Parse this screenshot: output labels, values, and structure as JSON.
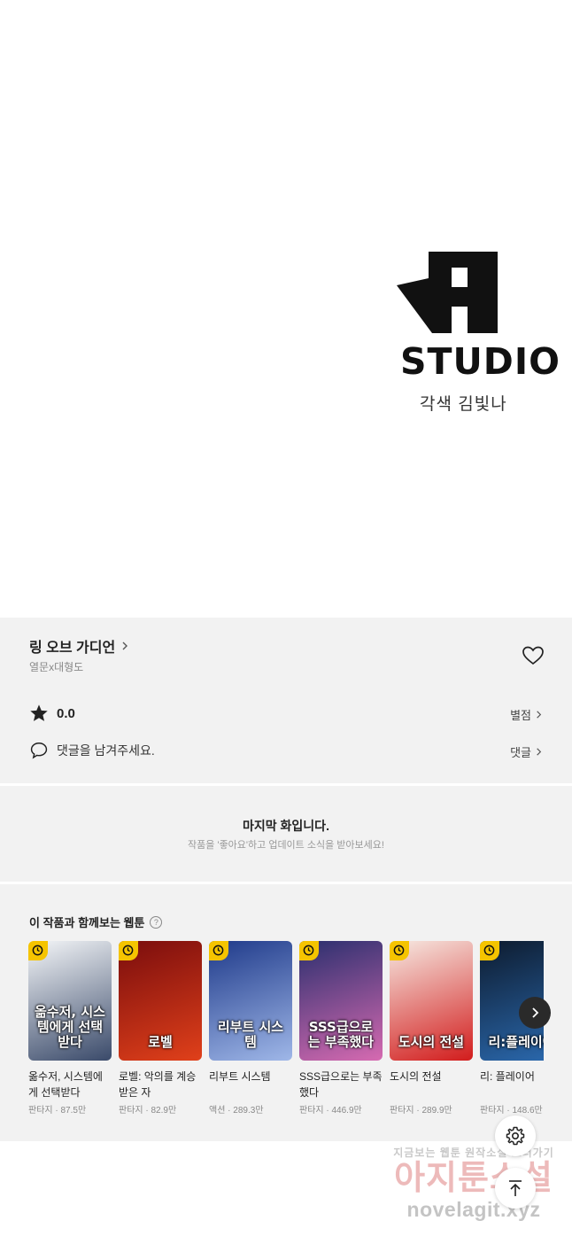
{
  "hero": {
    "logo_word": "STUDIO",
    "credit": "각색 김빛나"
  },
  "info": {
    "title": "링 오브 가디언",
    "authors": "열문x대형도",
    "rating": "0.0",
    "rating_link": "별점",
    "comment_prompt": "댓글을 남겨주세요.",
    "comment_link": "댓글"
  },
  "notice": {
    "title": "마지막 화입니다.",
    "subtitle": "작품을 '좋아요'하고 업데이트 소식을 받아보세요!"
  },
  "recommendations": {
    "heading": "이 작품과 함께보는 웹툰",
    "help_icon_text": "?",
    "items": [
      {
        "title": "옮수저, 시스템에게 선택받다",
        "genre": "판타지",
        "views": "87.5만",
        "cover_text": "옮수저, 시스템에게 선택받다",
        "colors": [
          "#f4f6f8",
          "#3a4a6a"
        ]
      },
      {
        "title": "로벨: 악의를 계승받은 자",
        "genre": "판타지",
        "views": "82.9만",
        "cover_text": "로벨",
        "colors": [
          "#7a0d0d",
          "#e0401a"
        ]
      },
      {
        "title": "리부트 시스템",
        "genre": "액션",
        "views": "289.3만",
        "cover_text": "리부트 시스템",
        "colors": [
          "#1f3a8a",
          "#9fb7e8"
        ]
      },
      {
        "title": "SSS급으로는 부족했다",
        "genre": "판타지",
        "views": "446.9만",
        "cover_text": "SSS급으로는 부족했다",
        "colors": [
          "#2a2f6e",
          "#d66ab1"
        ]
      },
      {
        "title": "도시의 전설",
        "genre": "판타지",
        "views": "289.9만",
        "cover_text": "도시의 전설",
        "colors": [
          "#f6e9e2",
          "#d21c1c"
        ]
      },
      {
        "title": "리: 플레이어",
        "genre": "판타지",
        "views": "148.6만",
        "cover_text": "리:플레이어",
        "colors": [
          "#0d1b2e",
          "#2b6ab0"
        ]
      }
    ]
  },
  "watermark": {
    "top": "지금보는 웹툰 원작소설 보러가기",
    "middle": "아지툰소설",
    "bottom": "novelagit.xyz"
  }
}
